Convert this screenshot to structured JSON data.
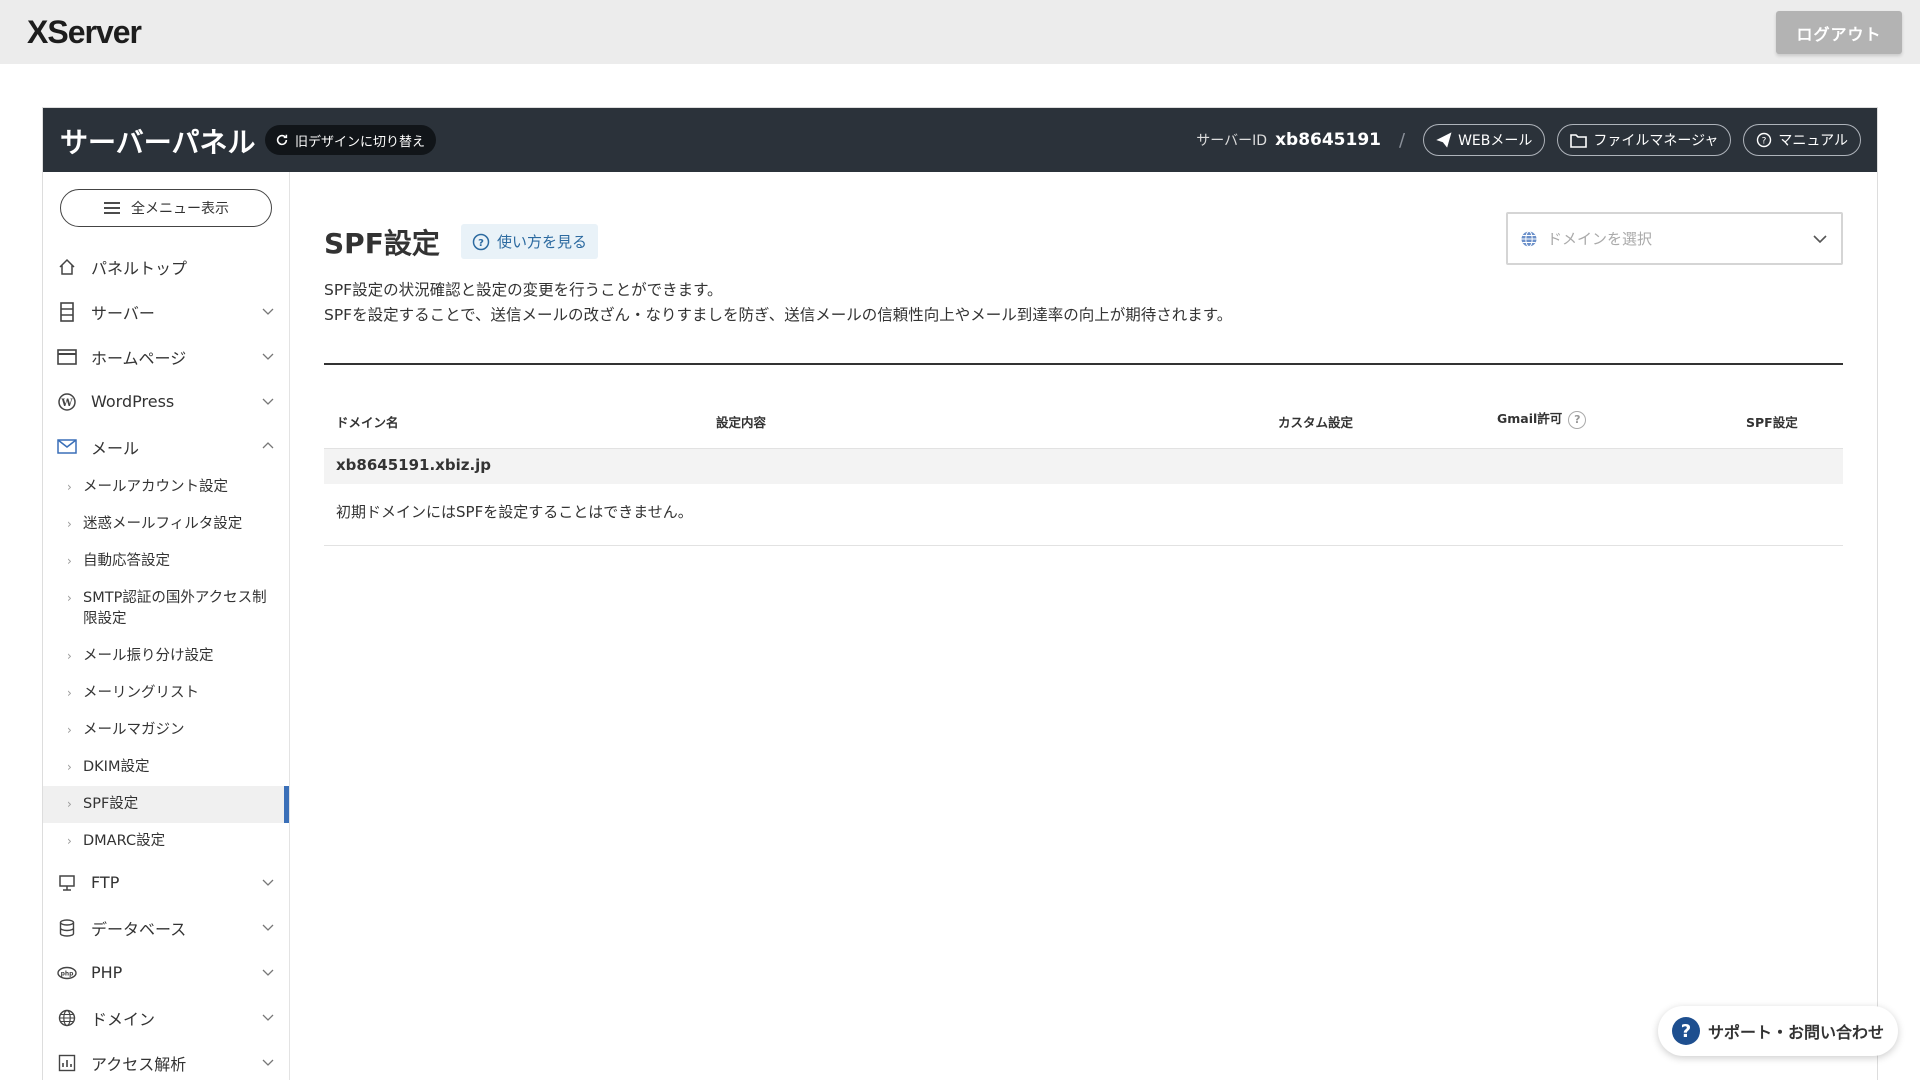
{
  "topbar": {
    "logo": "XServer",
    "logout_label": "ログアウト"
  },
  "header": {
    "title": "サーバーパネル",
    "switch_design_label": "旧デザインに切り替え",
    "server_id_label": "サーバーID",
    "server_id_value": "xb8645191",
    "separator": "/",
    "webmail_label": "WEBメール",
    "filemanager_label": "ファイルマネージャ",
    "manual_label": "マニュアル"
  },
  "sidebar": {
    "all_menu_label": "全メニュー表示",
    "items": [
      {
        "label": "パネルトップ",
        "icon": "home-icon"
      },
      {
        "label": "サーバー",
        "icon": "server-icon"
      },
      {
        "label": "ホームページ",
        "icon": "browser-icon"
      },
      {
        "label": "WordPress",
        "icon": "wordpress-icon"
      },
      {
        "label": "メール",
        "icon": "mail-icon"
      }
    ],
    "mail_sub": [
      "メールアカウント設定",
      "迷惑メールフィルタ設定",
      "自動応答設定",
      "SMTP認証の国外アクセス制限設定",
      "メール振り分け設定",
      "メーリングリスト",
      "メールマガジン",
      "DKIM設定",
      "SPF設定",
      "DMARC設定"
    ],
    "items_after": [
      {
        "label": "FTP",
        "icon": "ftp-icon"
      },
      {
        "label": "データベース",
        "icon": "database-icon"
      },
      {
        "label": "PHP",
        "icon": "php-icon"
      },
      {
        "label": "ドメイン",
        "icon": "globe-icon"
      },
      {
        "label": "アクセス解析",
        "icon": "chart-icon"
      }
    ]
  },
  "main": {
    "title": "SPF設定",
    "help_label": "使い方を見る",
    "domain_select_placeholder": "ドメインを選択",
    "desc_line1": "SPF設定の状況確認と設定の変更を行うことができます。",
    "desc_line2": "SPFを設定することで、送信メールの改ざん・なりすましを防ぎ、送信メールの信頼性向上やメール到達率の向上が期待されます。",
    "table": {
      "headers": [
        "ドメイン名",
        "設定内容",
        "カスタム設定",
        "Gmail許可",
        "SPF設定"
      ],
      "domain": "xb8645191.xbiz.jp",
      "message": "初期ドメインにはSPFを設定することはできません。"
    }
  },
  "support": {
    "label": "サポート・お問い合わせ"
  },
  "colors": {
    "header_bg": "#2b323a",
    "active_accent": "#3a6fb8",
    "support_icon": "#1e4f8f"
  }
}
